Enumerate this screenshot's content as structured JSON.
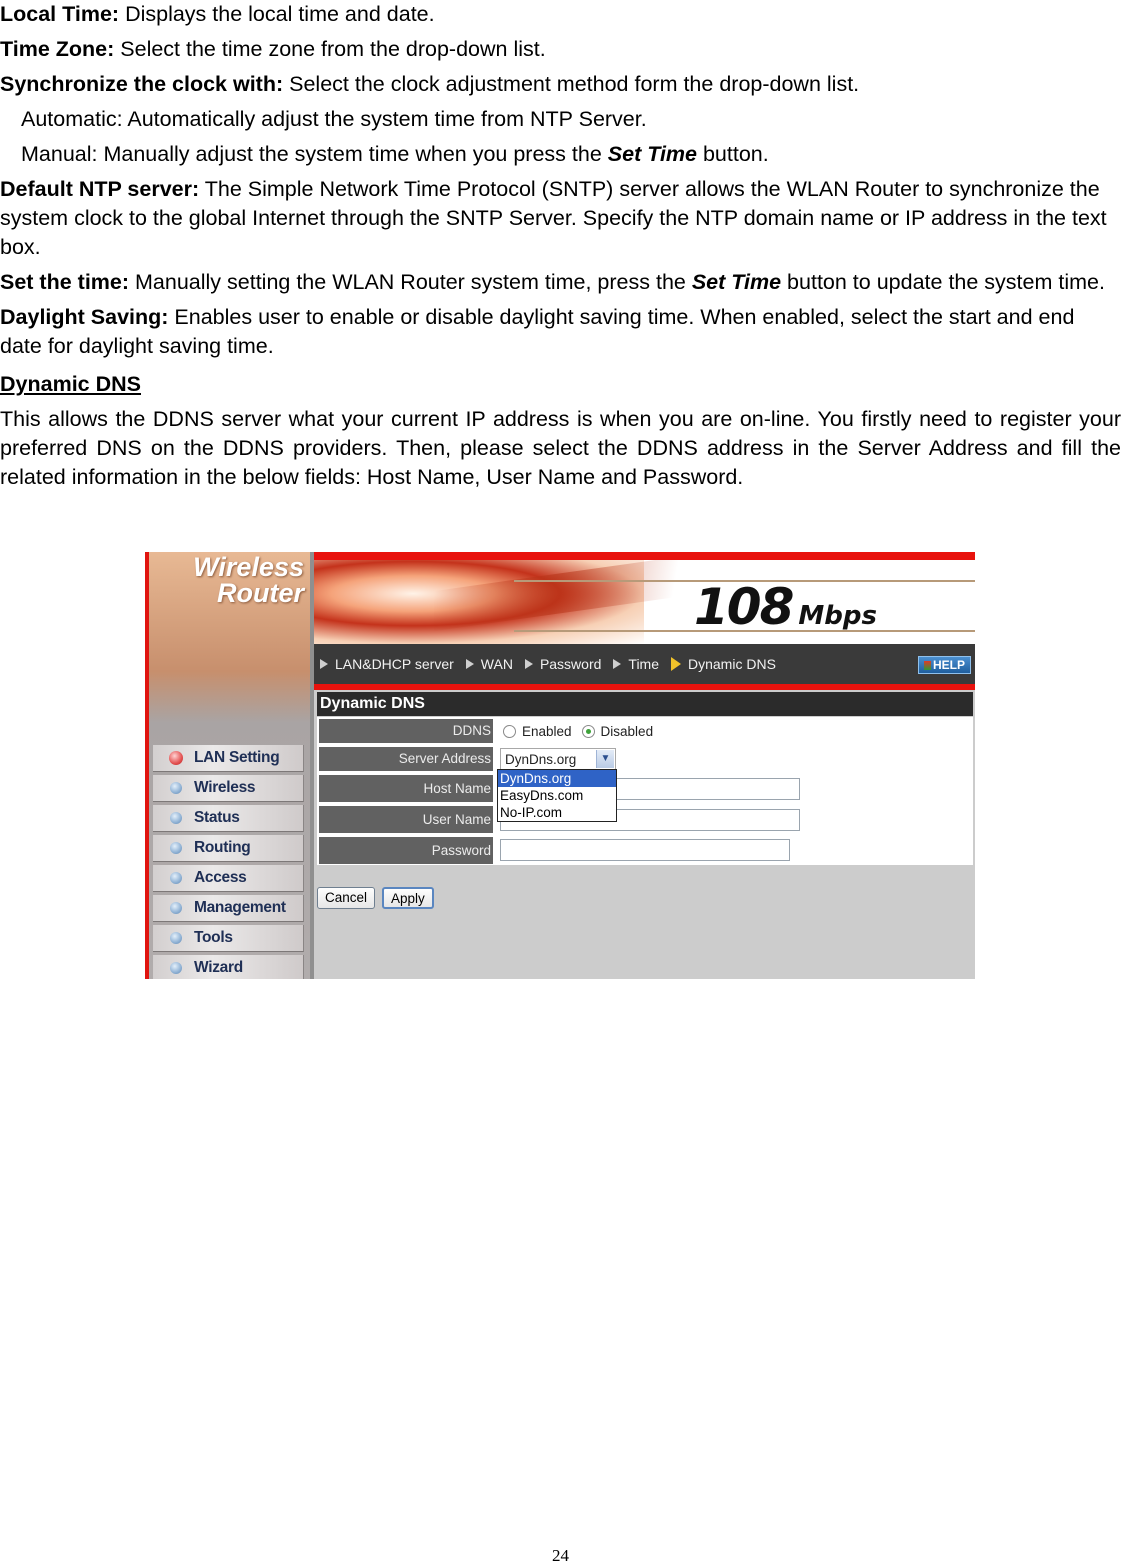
{
  "document": {
    "paragraphs": {
      "local_time": {
        "term": "Local Time:",
        "text": " Displays the local time and date."
      },
      "time_zone": {
        "term": "Time Zone:",
        "text": " Select the time zone from the drop-down list."
      },
      "sync": {
        "term": "Synchronize the clock with:",
        "text": " Select the clock adjustment method form the drop-down list."
      },
      "automatic": "Automatic: Automatically adjust the system time from NTP Server.",
      "manual_pre": "Manual: Manually adjust the system time when you press the ",
      "manual_em": "Set Time",
      "manual_post": " button.",
      "ntp": {
        "term": "Default NTP server:",
        "text": " The Simple Network Time Protocol (SNTP) server allows the WLAN Router to synchronize the system clock to the global Internet through the SNTP Server. Specify the NTP domain name or IP address in the text box."
      },
      "set_time": {
        "term": "Set the time:",
        "pre": " Manually setting the WLAN Router system time, press the ",
        "em": "Set Time",
        "post": " button to update the system time."
      },
      "daylight": {
        "term": "Daylight Saving:",
        "text": " Enables user to enable or disable daylight saving time. When enabled, select the start and end date for daylight saving time."
      }
    },
    "section_heading": "Dynamic DNS",
    "section_body": "This allows the DDNS server what your current IP address is when you are on-line.  You firstly need to register your preferred DNS on the DDNS providers.  Then, please select the DDNS address in the Server Address and fill the related information in the below fields: Host Name, User Name and Password.",
    "page_number": "24"
  },
  "router_ui": {
    "brand_line1": "Wireless",
    "brand_line2": "Router",
    "speed": "108",
    "speed_unit": "Mbps",
    "nav": [
      "LAN&DHCP server",
      "WAN",
      "Password",
      "Time",
      "Dynamic DNS"
    ],
    "nav_active": "Dynamic DNS",
    "help_label": "HELP",
    "sidebar": [
      "LAN Setting",
      "Wireless",
      "Status",
      "Routing",
      "Access",
      "Management",
      "Tools",
      "Wizard"
    ],
    "sidebar_active": "LAN Setting",
    "panel_title": "Dynamic DNS",
    "form": {
      "ddns_label": "DDNS",
      "ddns_options": [
        "Enabled",
        "Disabled"
      ],
      "ddns_selected": "Disabled",
      "server_label": "Server Address",
      "server_value": "DynDns.org",
      "server_options": [
        "DynDns.org",
        "EasyDns.com",
        "No-IP.com"
      ],
      "host_label": "Host Name",
      "host_value": "",
      "user_label": "User Name",
      "user_value": "",
      "password_label": "Password",
      "password_value": ""
    },
    "cancel_label": "Cancel",
    "apply_label": "Apply"
  }
}
